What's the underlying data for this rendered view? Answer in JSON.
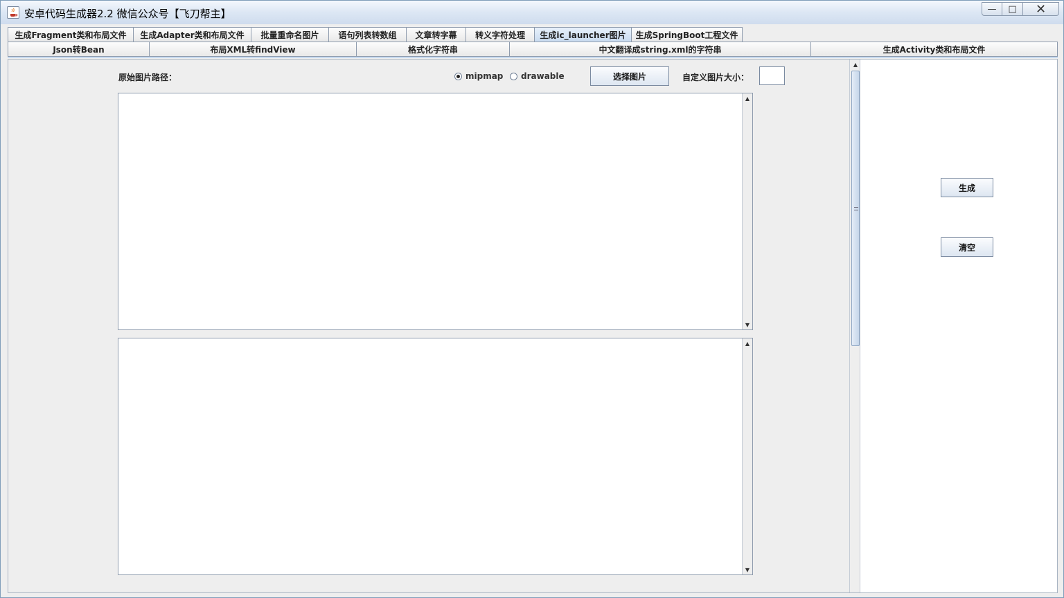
{
  "window": {
    "title": "安卓代码生成器2.2 微信公众号【飞刀帮主】",
    "controls": {
      "minimize": "—",
      "maximize": "□",
      "close": "✕"
    }
  },
  "tabs_row1": [
    "生成Fragment类和布局文件",
    "生成Adapter类和布局文件",
    "批量重命名图片",
    "语句列表转数组",
    "文章转字幕",
    "转义字符处理",
    "生成ic_launcher图片",
    "生成SpringBoot工程文件"
  ],
  "active_tab": "生成ic_launcher图片",
  "tabs_row2": [
    "Json转Bean",
    "布局XML转findView",
    "格式化字符串",
    "中文翻译成string.xml的字符串",
    "生成Activity类和布局文件"
  ],
  "form": {
    "path_label": "原始图片路径：",
    "radio_mipmap": "mipmap",
    "radio_drawable": "drawable",
    "selected_radio": "mipmap",
    "choose_button": "选择图片",
    "size_label": "自定义图片大小：",
    "size_value": ""
  },
  "actions": {
    "generate_button": "生成",
    "clear_button": "清空"
  },
  "icons": {
    "app": "java-cup-icon",
    "scroll_up": "▲",
    "scroll_down": "▼"
  }
}
